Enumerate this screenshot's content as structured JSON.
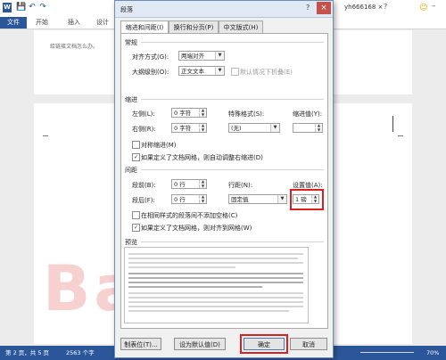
{
  "titlebar": {
    "word_icon_glyph": "W",
    "save_glyph": "💾",
    "undo_glyph": "↶",
    "redo_glyph": "↷",
    "user": "yh666168 ×",
    "help_glyph": "?",
    "min_glyph": "–",
    "smiley": "☺"
  },
  "ribbon": {
    "file_tab": "文件",
    "tabs": [
      "开始",
      "插入",
      "设计"
    ]
  },
  "document": {
    "text_line": "给链接文档怎么办。"
  },
  "watermark": "Bai 度",
  "statusbar": {
    "page": "第 2 页，共 5 页",
    "words": "2563 个字",
    "zoom": "70%"
  },
  "dialog": {
    "title": "段落",
    "help_glyph": "?",
    "close_glyph": "×",
    "tabs": [
      "缩进和间距(I)",
      "换行和分页(P)",
      "中文版式(H)"
    ],
    "general": {
      "section": "常规",
      "alignment_label": "对齐方式(G):",
      "alignment_value": "两端对齐",
      "outline_label": "大纲级别(O):",
      "outline_value": "正文文本",
      "collapse_label": "默认情况下折叠(E)"
    },
    "indent": {
      "section": "缩进",
      "left_label": "左侧(L):",
      "left_value": "0 字符",
      "right_label": "右侧(R):",
      "right_value": "0 字符",
      "special_label": "特殊格式(S):",
      "special_value": "(无)",
      "indent_value_label": "缩进值(Y):",
      "mirror_label": "对称缩进(M)",
      "auto_adjust_label": "如果定义了文档网格，则自动调整右缩进(D)"
    },
    "spacing": {
      "section": "间距",
      "before_label": "段前(B):",
      "before_value": "0 行",
      "after_label": "段后(F):",
      "after_value": "0 行",
      "line_label": "行距(N):",
      "line_value": "固定值",
      "set_label": "设置值(A):",
      "set_value": "1 磅",
      "no_space_label": "在相同样式的段落间不添加空格(C)",
      "snap_grid_label": "如果定义了文档网格，则对齐到网格(W)"
    },
    "preview": {
      "section": "预览"
    },
    "buttons": {
      "tabs": "制表位(T)...",
      "default": "设为默认值(D)",
      "ok": "确定",
      "cancel": "取消"
    }
  }
}
